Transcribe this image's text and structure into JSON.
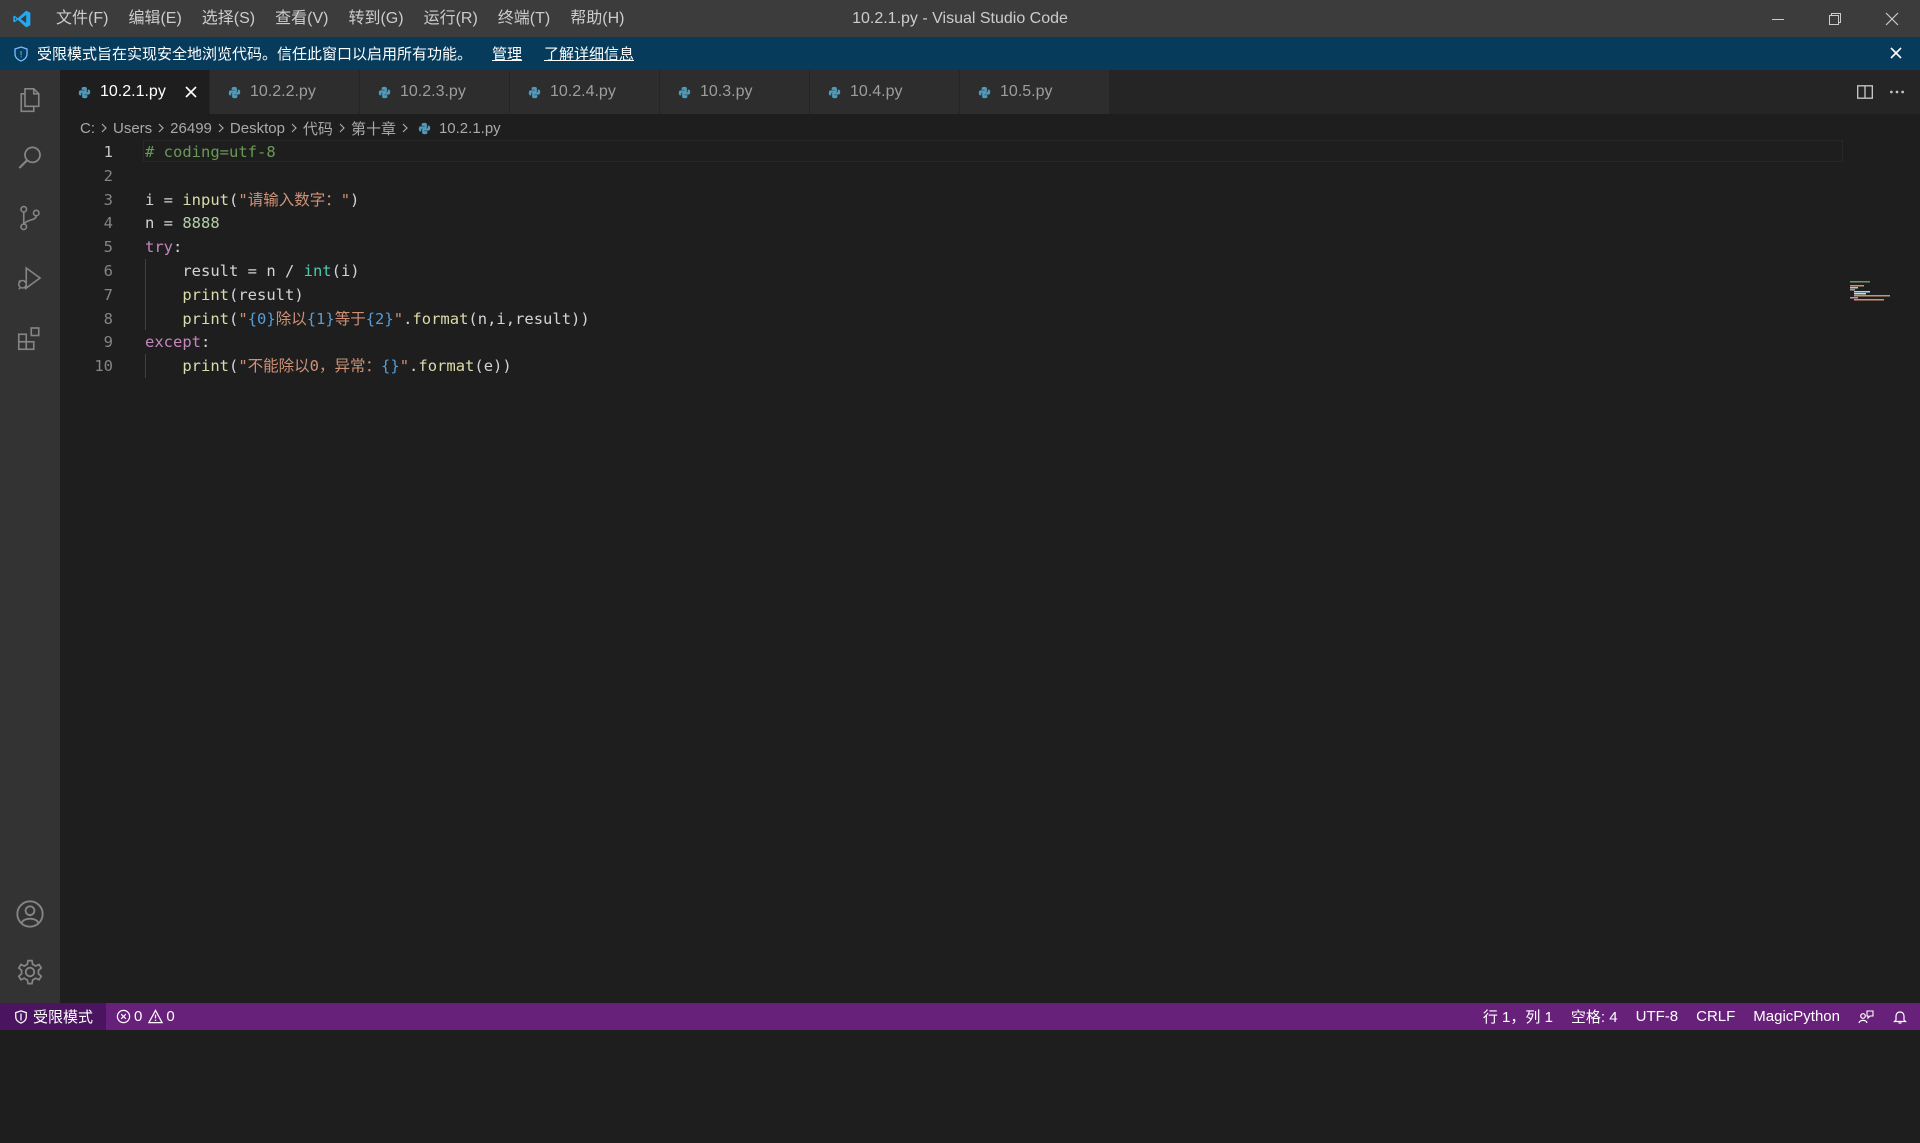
{
  "window": {
    "title": "10.2.1.py - Visual Studio Code",
    "menu": [
      "文件(F)",
      "编辑(E)",
      "选择(S)",
      "查看(V)",
      "转到(G)",
      "运行(R)",
      "终端(T)",
      "帮助(H)"
    ]
  },
  "banner": {
    "text": "受限模式旨在实现安全地浏览代码。信任此窗口以启用所有功能。",
    "manage_link": "管理",
    "learn_more_link": "了解详细信息"
  },
  "activity_bar": {
    "top": [
      "explorer-icon",
      "search-icon",
      "source-control-icon",
      "run-debug-icon",
      "extensions-icon"
    ],
    "bottom": [
      "accounts-icon",
      "settings-gear-icon"
    ]
  },
  "tabs": [
    {
      "label": "10.2.1.py",
      "active": true
    },
    {
      "label": "10.2.2.py",
      "active": false
    },
    {
      "label": "10.2.3.py",
      "active": false
    },
    {
      "label": "10.2.4.py",
      "active": false
    },
    {
      "label": "10.3.py",
      "active": false
    },
    {
      "label": "10.4.py",
      "active": false
    },
    {
      "label": "10.5.py",
      "active": false
    }
  ],
  "breadcrumb": [
    "C:",
    "Users",
    "26499",
    "Desktop",
    "代码",
    "第十章",
    "10.2.1.py"
  ],
  "editor": {
    "active_line": 1,
    "lines": [
      {
        "num": "1",
        "tokens": [
          {
            "t": "# coding=utf-8",
            "c": "cm"
          }
        ]
      },
      {
        "num": "2",
        "tokens": []
      },
      {
        "num": "3",
        "tokens": [
          {
            "t": "i",
            "c": "vr"
          },
          {
            "t": " = ",
            "c": "vr"
          },
          {
            "t": "input",
            "c": "fn"
          },
          {
            "t": "(",
            "c": "vr"
          },
          {
            "t": "\"请输入数字：\"",
            "c": "st"
          },
          {
            "t": ")",
            "c": "vr"
          }
        ]
      },
      {
        "num": "4",
        "tokens": [
          {
            "t": "n",
            "c": "vr"
          },
          {
            "t": " = ",
            "c": "vr"
          },
          {
            "t": "8888",
            "c": "nm"
          }
        ]
      },
      {
        "num": "5",
        "tokens": [
          {
            "t": "try",
            "c": "kw"
          },
          {
            "t": ":",
            "c": "vr"
          }
        ]
      },
      {
        "num": "6",
        "tokens": [
          {
            "t": "    result = n / ",
            "c": "vr"
          },
          {
            "t": "int",
            "c": "bi"
          },
          {
            "t": "(i)",
            "c": "vr"
          }
        ]
      },
      {
        "num": "7",
        "tokens": [
          {
            "t": "    ",
            "c": "vr"
          },
          {
            "t": "print",
            "c": "fn"
          },
          {
            "t": "(result)",
            "c": "vr"
          }
        ]
      },
      {
        "num": "8",
        "tokens": [
          {
            "t": "    ",
            "c": "vr"
          },
          {
            "t": "print",
            "c": "fn"
          },
          {
            "t": "(",
            "c": "vr"
          },
          {
            "t": "\"",
            "c": "st"
          },
          {
            "t": "{0}",
            "c": "ph"
          },
          {
            "t": "除以",
            "c": "st"
          },
          {
            "t": "{1}",
            "c": "ph"
          },
          {
            "t": "等于",
            "c": "st"
          },
          {
            "t": "{2}",
            "c": "ph"
          },
          {
            "t": "\"",
            "c": "st"
          },
          {
            "t": ".",
            "c": "vr"
          },
          {
            "t": "format",
            "c": "fn"
          },
          {
            "t": "(n,i,result))",
            "c": "vr"
          }
        ]
      },
      {
        "num": "9",
        "tokens": [
          {
            "t": "except",
            "c": "kw"
          },
          {
            "t": ":",
            "c": "vr"
          }
        ]
      },
      {
        "num": "10",
        "tokens": [
          {
            "t": "    ",
            "c": "vr"
          },
          {
            "t": "print",
            "c": "fn"
          },
          {
            "t": "(",
            "c": "vr"
          },
          {
            "t": "\"不能除以0，异常：",
            "c": "st"
          },
          {
            "t": "{}",
            "c": "ph"
          },
          {
            "t": "\"",
            "c": "st"
          },
          {
            "t": ".",
            "c": "vr"
          },
          {
            "t": "format",
            "c": "fn"
          },
          {
            "t": "(e))",
            "c": "vr"
          }
        ]
      }
    ]
  },
  "status_bar": {
    "restricted_mode": "受限模式",
    "errors": "0",
    "warnings": "0",
    "cursor_position": "行 1，列 1",
    "indent": "空格: 4",
    "encoding": "UTF-8",
    "eol": "CRLF",
    "language": "MagicPython"
  },
  "colors": {
    "accent_status_bar": "#68217a",
    "banner_bg": "#063b5b",
    "editor_bg": "#1e1e1e",
    "python_icon": "#519aba"
  }
}
